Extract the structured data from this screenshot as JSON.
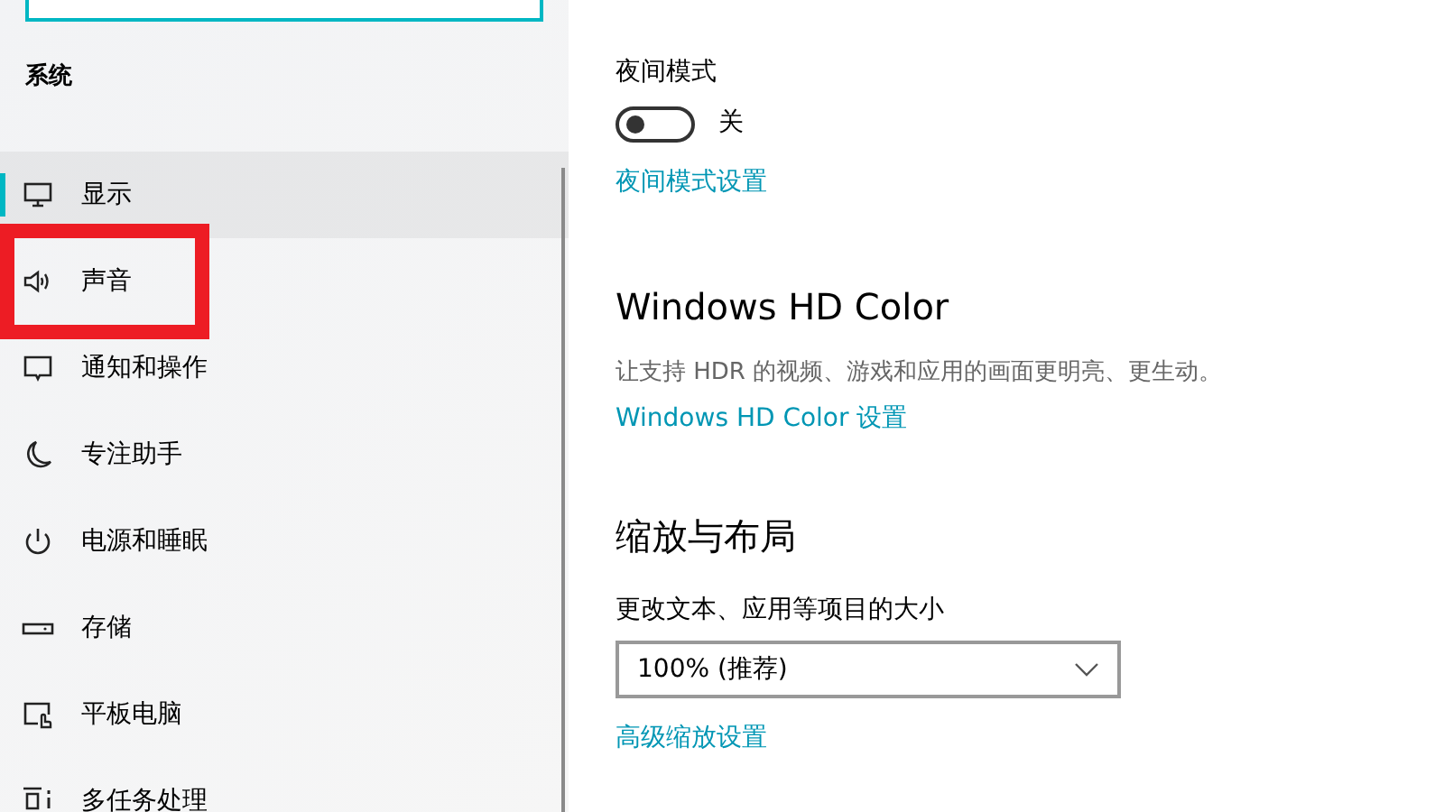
{
  "sidebar": {
    "heading": "系统",
    "items": [
      {
        "label": "显示",
        "kind": "display",
        "selected": true,
        "highlighted": false
      },
      {
        "label": "声音",
        "kind": "sound",
        "selected": false,
        "highlighted": true
      },
      {
        "label": "通知和操作",
        "kind": "notify",
        "selected": false,
        "highlighted": false
      },
      {
        "label": "专注助手",
        "kind": "moon",
        "selected": false,
        "highlighted": false
      },
      {
        "label": "电源和睡眠",
        "kind": "power",
        "selected": false,
        "highlighted": false
      },
      {
        "label": "存储",
        "kind": "storage",
        "selected": false,
        "highlighted": false
      },
      {
        "label": "平板电脑",
        "kind": "tablet",
        "selected": false,
        "highlighted": false
      },
      {
        "label": "多任务处理",
        "kind": "multitask",
        "selected": false,
        "highlighted": false
      }
    ]
  },
  "content": {
    "night_mode": {
      "label": "夜间模式",
      "on": false,
      "state_text": "关",
      "link": "夜间模式设置"
    },
    "hdr": {
      "heading": "Windows HD Color",
      "description": "让支持 HDR 的视频、游戏和应用的画面更明亮、更生动。",
      "link": "Windows HD Color 设置"
    },
    "scale": {
      "heading": "缩放与布局",
      "label": "更改文本、应用等项目的大小",
      "value": "100% (推荐)",
      "link": "高级缩放设置"
    }
  }
}
